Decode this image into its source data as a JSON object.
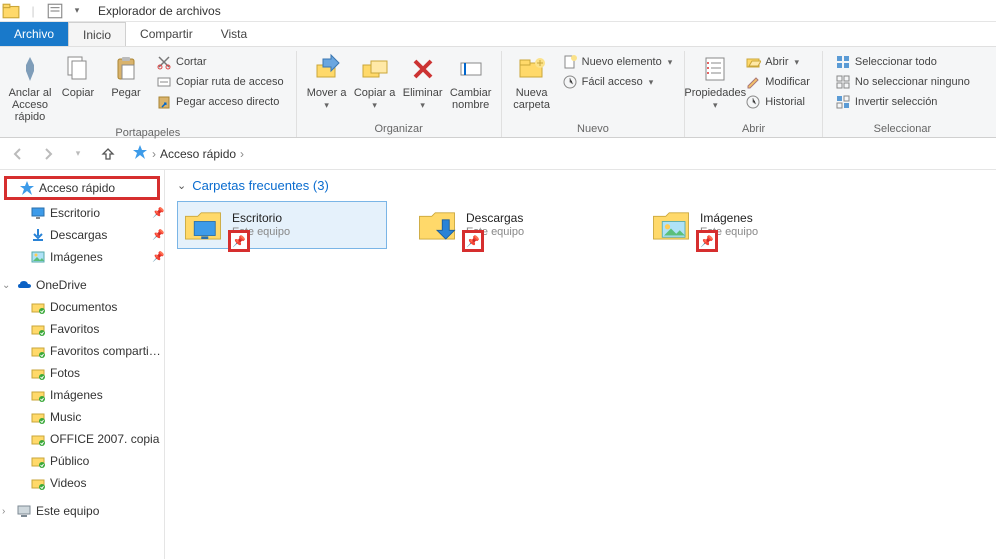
{
  "title": "Explorador de archivos",
  "ribbon": {
    "tabs": {
      "file": "Archivo",
      "home": "Inicio",
      "share": "Compartir",
      "view": "Vista"
    },
    "groups": {
      "clipboard": {
        "label": "Portapapeles",
        "pin": "Anclar al Acceso rápido",
        "copy": "Copiar",
        "paste": "Pegar",
        "cut": "Cortar",
        "copy_path": "Copiar ruta de acceso",
        "paste_shortcut": "Pegar acceso directo"
      },
      "organize": {
        "label": "Organizar",
        "move": "Mover a",
        "copy_to": "Copiar a",
        "delete": "Eliminar",
        "rename": "Cambiar nombre"
      },
      "new": {
        "label": "Nuevo",
        "new_folder": "Nueva carpeta",
        "new_item": "Nuevo elemento",
        "easy_access": "Fácil acceso"
      },
      "open": {
        "label": "Abrir",
        "properties": "Propiedades",
        "open": "Abrir",
        "edit": "Modificar",
        "history": "Historial"
      },
      "select": {
        "label": "Seleccionar",
        "select_all": "Seleccionar todo",
        "select_none": "No seleccionar ninguno",
        "invert": "Invertir selección"
      }
    }
  },
  "breadcrumb": {
    "root": "Acceso rápido"
  },
  "sidebar": {
    "quick_access": "Acceso rápido",
    "quick_items": [
      {
        "label": "Escritorio"
      },
      {
        "label": "Descargas"
      },
      {
        "label": "Imágenes"
      }
    ],
    "onedrive": "OneDrive",
    "onedrive_items": [
      {
        "label": "Documentos"
      },
      {
        "label": "Favoritos"
      },
      {
        "label": "Favoritos compartidos"
      },
      {
        "label": "Fotos"
      },
      {
        "label": "Imágenes"
      },
      {
        "label": "Music"
      },
      {
        "label": "OFFICE 2007. copia"
      },
      {
        "label": "Público"
      },
      {
        "label": "Videos"
      }
    ],
    "this_pc": "Este equipo"
  },
  "section": {
    "header": "Carpetas frecuentes (3)",
    "items": [
      {
        "name": "Escritorio",
        "sub": "Este equipo"
      },
      {
        "name": "Descargas",
        "sub": "Este equipo"
      },
      {
        "name": "Imágenes",
        "sub": "Este equipo"
      }
    ]
  }
}
